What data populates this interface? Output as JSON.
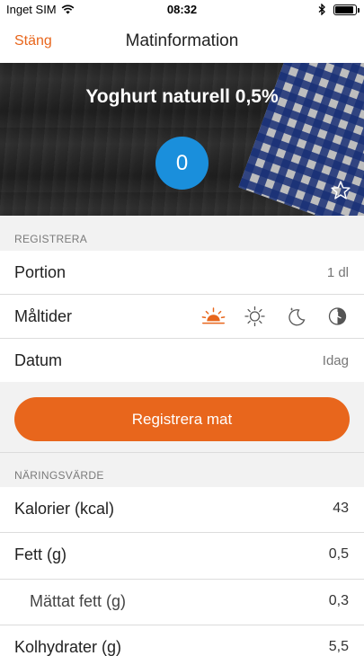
{
  "status": {
    "carrier": "Inget SIM",
    "time": "08:32",
    "battery_level": 0.9
  },
  "nav": {
    "close_label": "Stäng",
    "title": "Matinformation"
  },
  "hero": {
    "food_name": "Yoghurt naturell 0,5%",
    "score": "0"
  },
  "register": {
    "section_label": "REGISTRERA",
    "portion": {
      "label": "Portion",
      "value": "1 dl"
    },
    "meals": {
      "label": "Måltider",
      "icons": [
        "sunrise-icon",
        "sun-icon",
        "moon-icon",
        "night-clock-icon"
      ],
      "active_color": "#e8661c"
    },
    "date": {
      "label": "Datum",
      "value": "Idag"
    },
    "button_label": "Registrera mat"
  },
  "nutrition": {
    "section_label": "NÄRINGSVÄRDE",
    "rows": [
      {
        "label": "Kalorier (kcal)",
        "value": "43"
      },
      {
        "label": "Fett (g)",
        "value": "0,5"
      },
      {
        "label": "Mättat fett (g)",
        "value": "0,3"
      },
      {
        "label": "Kolhydrater (g)",
        "value": "5,5"
      }
    ]
  },
  "colors": {
    "accent": "#e8661c",
    "score_blue": "#1a8fdc"
  }
}
